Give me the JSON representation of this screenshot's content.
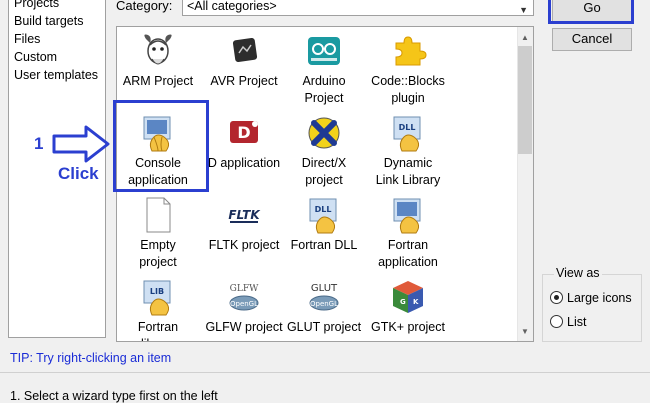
{
  "categories_list": {
    "items": [
      "Projects",
      "Build targets",
      "Files",
      "Custom",
      "User templates"
    ],
    "selected": "Projects"
  },
  "category_filter": {
    "label": "Category:",
    "value": "<All categories>"
  },
  "wizards": [
    {
      "label": "ARM Project",
      "icon": "gnu-gnu-icon"
    },
    {
      "label": "AVR Project",
      "icon": "avr-chip-icon"
    },
    {
      "label": "Arduino\nProject",
      "icon": "arduino-logo-icon"
    },
    {
      "label": "Code::Blocks\nplugin",
      "icon": "puzzle-piece-icon"
    },
    {
      "label": "Console\napplication",
      "icon": "console-app-icon",
      "selected": true
    },
    {
      "label": "D application",
      "icon": "d-language-icon"
    },
    {
      "label": "Direct/X\nproject",
      "icon": "directx-icon"
    },
    {
      "label": "Dynamic\nLink Library",
      "icon": "dll-icon"
    },
    {
      "label": "Empty\nproject",
      "icon": "blank-page-icon"
    },
    {
      "label": "FLTK project",
      "icon": "fltk-icon"
    },
    {
      "label": "Fortran DLL",
      "icon": "fortran-dll-icon"
    },
    {
      "label": "Fortran\napplication",
      "icon": "fortran-app-icon"
    },
    {
      "label": "Fortran\nlibrary",
      "icon": "fortran-lib-icon"
    },
    {
      "label": "GLFW project",
      "icon": "glfw-opengl-icon"
    },
    {
      "label": "GLUT project",
      "icon": "glut-opengl-icon"
    },
    {
      "label": "GTK+ project",
      "icon": "gtk-cube-icon"
    }
  ],
  "annotation": {
    "number": "1",
    "click_text": "Click"
  },
  "buttons": {
    "go": "Go",
    "cancel": "Cancel"
  },
  "view_as": {
    "label": "View as",
    "options": [
      "Large icons",
      "List"
    ],
    "selected": "Large icons"
  },
  "tip": "TIP: Try right-clicking an item",
  "instruction": "1. Select a wizard type first on the left",
  "colors": {
    "annotation": "#2b3fd0",
    "tip": "#1a2cd6"
  }
}
